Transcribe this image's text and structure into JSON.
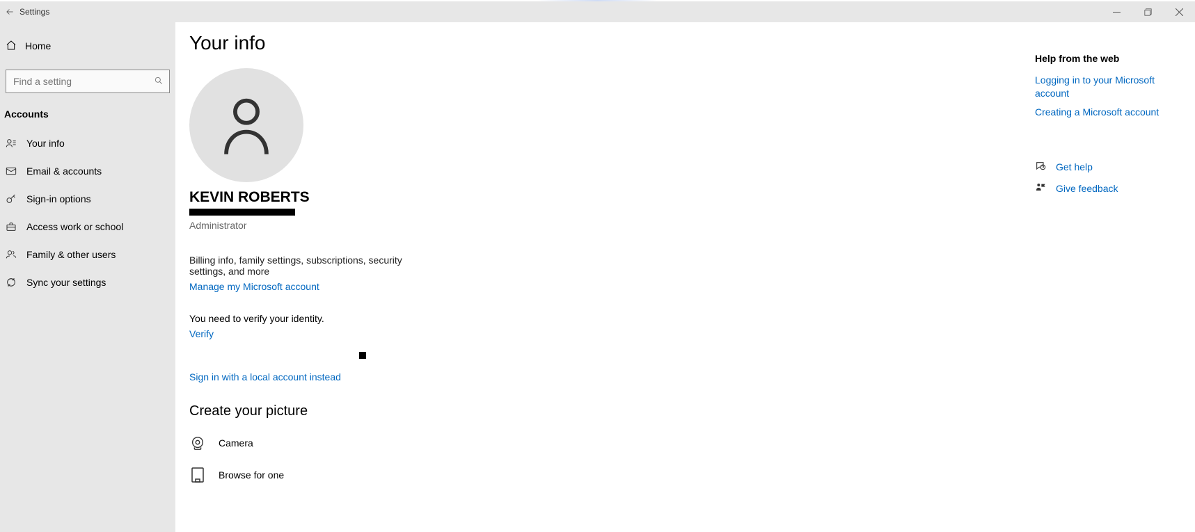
{
  "titlebar": {
    "title": "Settings"
  },
  "sidebar": {
    "home": "Home",
    "search_placeholder": "Find a setting",
    "section": "Accounts",
    "items": [
      {
        "label": "Your info"
      },
      {
        "label": "Email & accounts"
      },
      {
        "label": "Sign-in options"
      },
      {
        "label": "Access work or school"
      },
      {
        "label": "Family & other users"
      },
      {
        "label": "Sync your settings"
      }
    ]
  },
  "page": {
    "title": "Your info",
    "username": "KEVIN ROBERTS",
    "role": "Administrator",
    "description": "Billing info, family settings, subscriptions, security settings, and more",
    "manage_link": "Manage my Microsoft account",
    "verify_msg": "You need to verify your identity.",
    "verify_link": "Verify",
    "local_signin_link": "Sign in with a local account instead",
    "picture_heading": "Create your picture",
    "camera_label": "Camera",
    "browse_label": "Browse for one"
  },
  "right": {
    "heading": "Help from the web",
    "links": [
      "Logging in to your Microsoft account",
      "Creating a Microsoft account"
    ],
    "get_help": "Get help",
    "feedback": "Give feedback"
  }
}
